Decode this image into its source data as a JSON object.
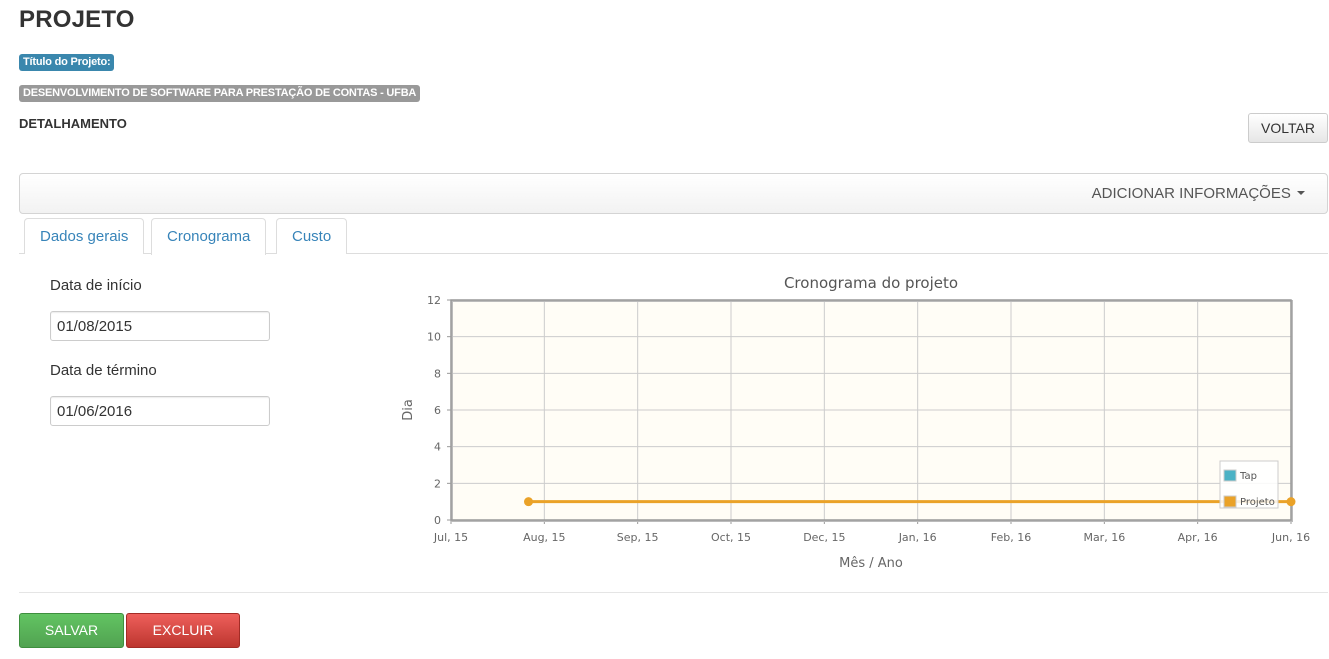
{
  "page": {
    "title": "PROJETO",
    "title_badge": "Título do Projeto:",
    "project_name": "DESENVOLVIMENTO DE SOFTWARE PARA PRESTAÇÃO DE CONTAS - UFBA",
    "section_heading": "DETALHAMENTO",
    "back_button": "VOLTAR"
  },
  "navbar": {
    "dropdown_label": "ADICIONAR INFORMAÇÕES"
  },
  "tabs": [
    {
      "label": "Dados gerais",
      "active": false
    },
    {
      "label": "Cronograma",
      "active": true
    },
    {
      "label": "Custo",
      "active": false
    }
  ],
  "form": {
    "start_label": "Data de início",
    "start_value": "01/08/2015",
    "end_label": "Data de término",
    "end_value": "01/06/2016"
  },
  "actions": {
    "save_label": "SALVAR",
    "delete_label": "EXCLUIR"
  },
  "colors": {
    "tap": "#4bb2c5",
    "projeto": "#eaa228",
    "plot_bg": "#fffdf6",
    "save": "#5bb75b",
    "delete": "#da4f49"
  },
  "chart_data": {
    "type": "line",
    "title": "Cronograma do projeto",
    "xlabel": "Mês / Ano",
    "ylabel": "Dia",
    "x_ticks": [
      "Jul, 15",
      "Aug, 15",
      "Sep, 15",
      "Oct, 15",
      "Dec, 15",
      "Jan, 16",
      "Feb, 16",
      "Mar, 16",
      "Apr, 16",
      "Jun, 16"
    ],
    "xlim": [
      "2015-07-01",
      "2016-06-01"
    ],
    "ylim": [
      0,
      12
    ],
    "y_ticks": [
      0,
      2,
      4,
      6,
      8,
      10,
      12
    ],
    "grid": true,
    "legend_position": "bottom-right",
    "series": [
      {
        "name": "Tap",
        "x": [],
        "y": []
      },
      {
        "name": "Projeto",
        "x": [
          "2015-08-01",
          "2016-06-01"
        ],
        "y": [
          1,
          1
        ]
      }
    ]
  }
}
